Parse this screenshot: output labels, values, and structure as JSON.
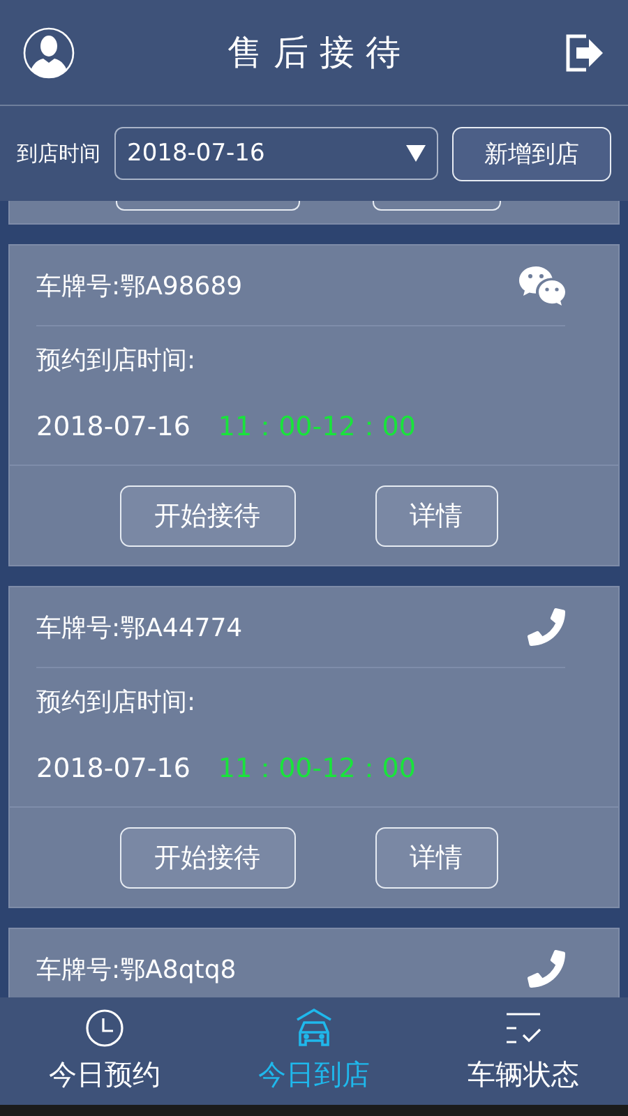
{
  "header": {
    "title": "售后接待"
  },
  "filter": {
    "label": "到店时间",
    "date": "2018-07-16",
    "add_button": "新增到店"
  },
  "cards": [
    {
      "plate": "车牌号:鄂A98689",
      "kind": "wechat",
      "time_label": "预约到店时间:",
      "date": "2018-07-16",
      "slot": "11：00-12：00",
      "buttons": [
        "开始接待",
        "详情"
      ]
    },
    {
      "plate": "车牌号:鄂A44774",
      "kind": "phone",
      "time_label": "预约到店时间:",
      "date": "2018-07-16",
      "slot": "11：00-12：00",
      "buttons": [
        "开始接待",
        "详情"
      ]
    },
    {
      "plate": "车牌号:鄂A8qtq8",
      "kind": "phone"
    }
  ],
  "nav": [
    {
      "kind": "clock",
      "label": "今日预约",
      "selected": false
    },
    {
      "kind": "car",
      "label": "今日到店",
      "selected": true
    },
    {
      "kind": "checklist",
      "label": "车辆状态",
      "selected": false
    }
  ]
}
